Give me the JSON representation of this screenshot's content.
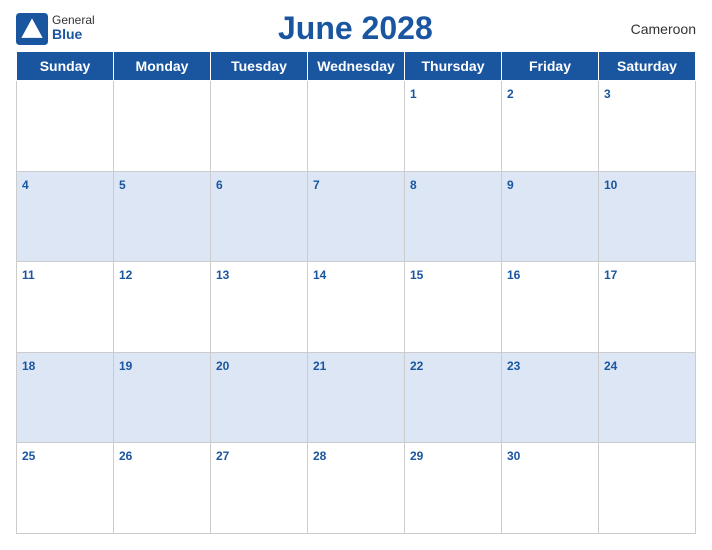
{
  "header": {
    "logo_general": "General",
    "logo_blue": "Blue",
    "title": "June 2028",
    "country": "Cameroon"
  },
  "days_of_week": [
    "Sunday",
    "Monday",
    "Tuesday",
    "Wednesday",
    "Thursday",
    "Friday",
    "Saturday"
  ],
  "weeks": [
    [
      null,
      null,
      null,
      null,
      1,
      2,
      3
    ],
    [
      4,
      5,
      6,
      7,
      8,
      9,
      10
    ],
    [
      11,
      12,
      13,
      14,
      15,
      16,
      17
    ],
    [
      18,
      19,
      20,
      21,
      22,
      23,
      24
    ],
    [
      25,
      26,
      27,
      28,
      29,
      30,
      null
    ]
  ]
}
